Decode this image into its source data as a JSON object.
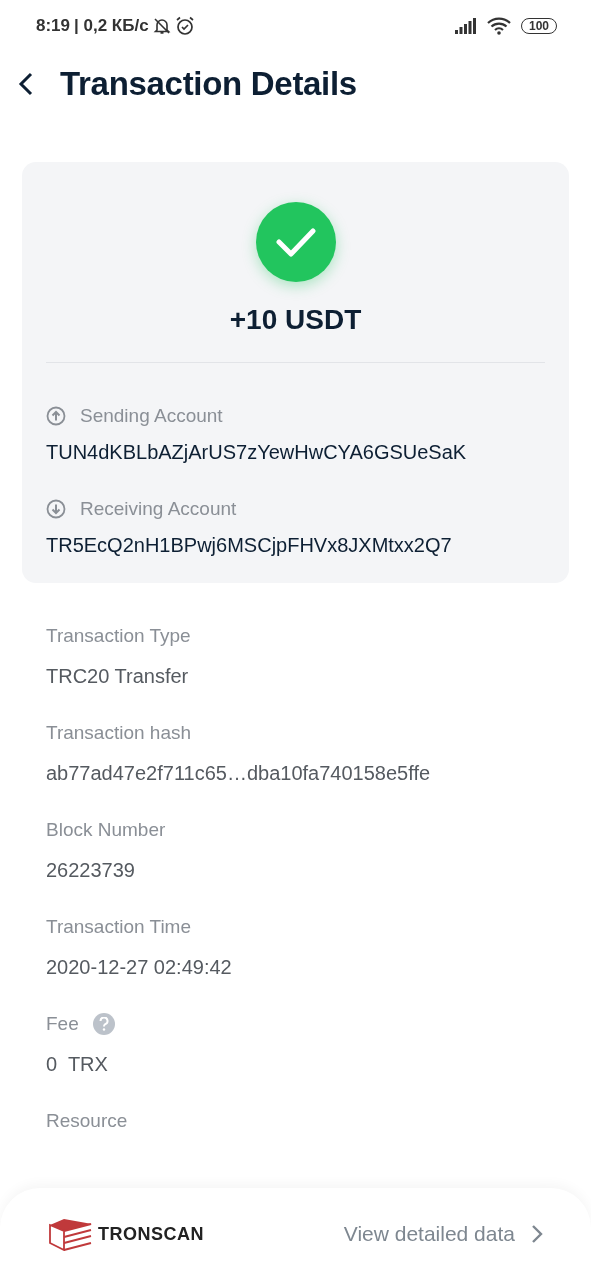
{
  "status_bar": {
    "time": "8:19",
    "speed": "| 0,2 КБ/с",
    "battery": "100"
  },
  "header": {
    "title": "Transaction Details"
  },
  "summary": {
    "amount": "+10 USDT",
    "accounts": [
      {
        "kind": "sending",
        "label": "Sending Account",
        "address": "TUN4dKBLbAZjArUS7zYewHwCYA6GSUeSaK"
      },
      {
        "kind": "receiving",
        "label": "Receiving Account",
        "address": "TR5EcQ2nH1BPwj6MSCjpFHVx8JXMtxx2Q7"
      }
    ]
  },
  "details": [
    {
      "kind": "plain",
      "label": "Transaction Type",
      "value": "TRC20 Transfer"
    },
    {
      "kind": "plain",
      "label": "Transaction hash",
      "value": "ab77ad47e2f711c65…dba10fa740158e5ffe"
    },
    {
      "kind": "plain",
      "label": "Block Number",
      "value": "26223739"
    },
    {
      "kind": "plain",
      "label": "Transaction Time",
      "value": "2020-12-27 02:49:42"
    },
    {
      "kind": "help",
      "label": "Fee",
      "value": "0  TRX"
    },
    {
      "kind": "plain",
      "label": "Resource"
    }
  ],
  "footer": {
    "brand": "TRONSCAN",
    "link": "View detailed data"
  }
}
